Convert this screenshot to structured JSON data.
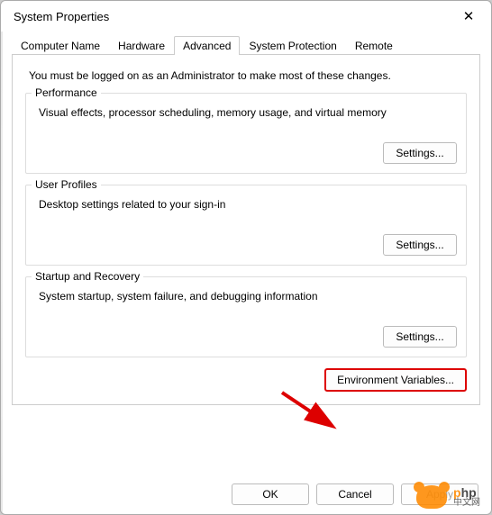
{
  "window": {
    "title": "System Properties",
    "close_icon": "✕"
  },
  "tabs": {
    "computer_name": "Computer Name",
    "hardware": "Hardware",
    "advanced": "Advanced",
    "system_protection": "System Protection",
    "remote": "Remote"
  },
  "advanced": {
    "admin_note": "You must be logged on as an Administrator to make most of these changes.",
    "performance": {
      "title": "Performance",
      "desc": "Visual effects, processor scheduling, memory usage, and virtual memory",
      "settings_label": "Settings..."
    },
    "user_profiles": {
      "title": "User Profiles",
      "desc": "Desktop settings related to your sign-in",
      "settings_label": "Settings..."
    },
    "startup_recovery": {
      "title": "Startup and Recovery",
      "desc": "System startup, system failure, and debugging information",
      "settings_label": "Settings..."
    },
    "env_vars_label": "Environment Variables..."
  },
  "footer": {
    "ok": "OK",
    "cancel": "Cancel",
    "apply": "Apply"
  },
  "watermark": {
    "brand_prefix": "p",
    "brand_suffix": "hp",
    "brand_cn": "中文网"
  }
}
